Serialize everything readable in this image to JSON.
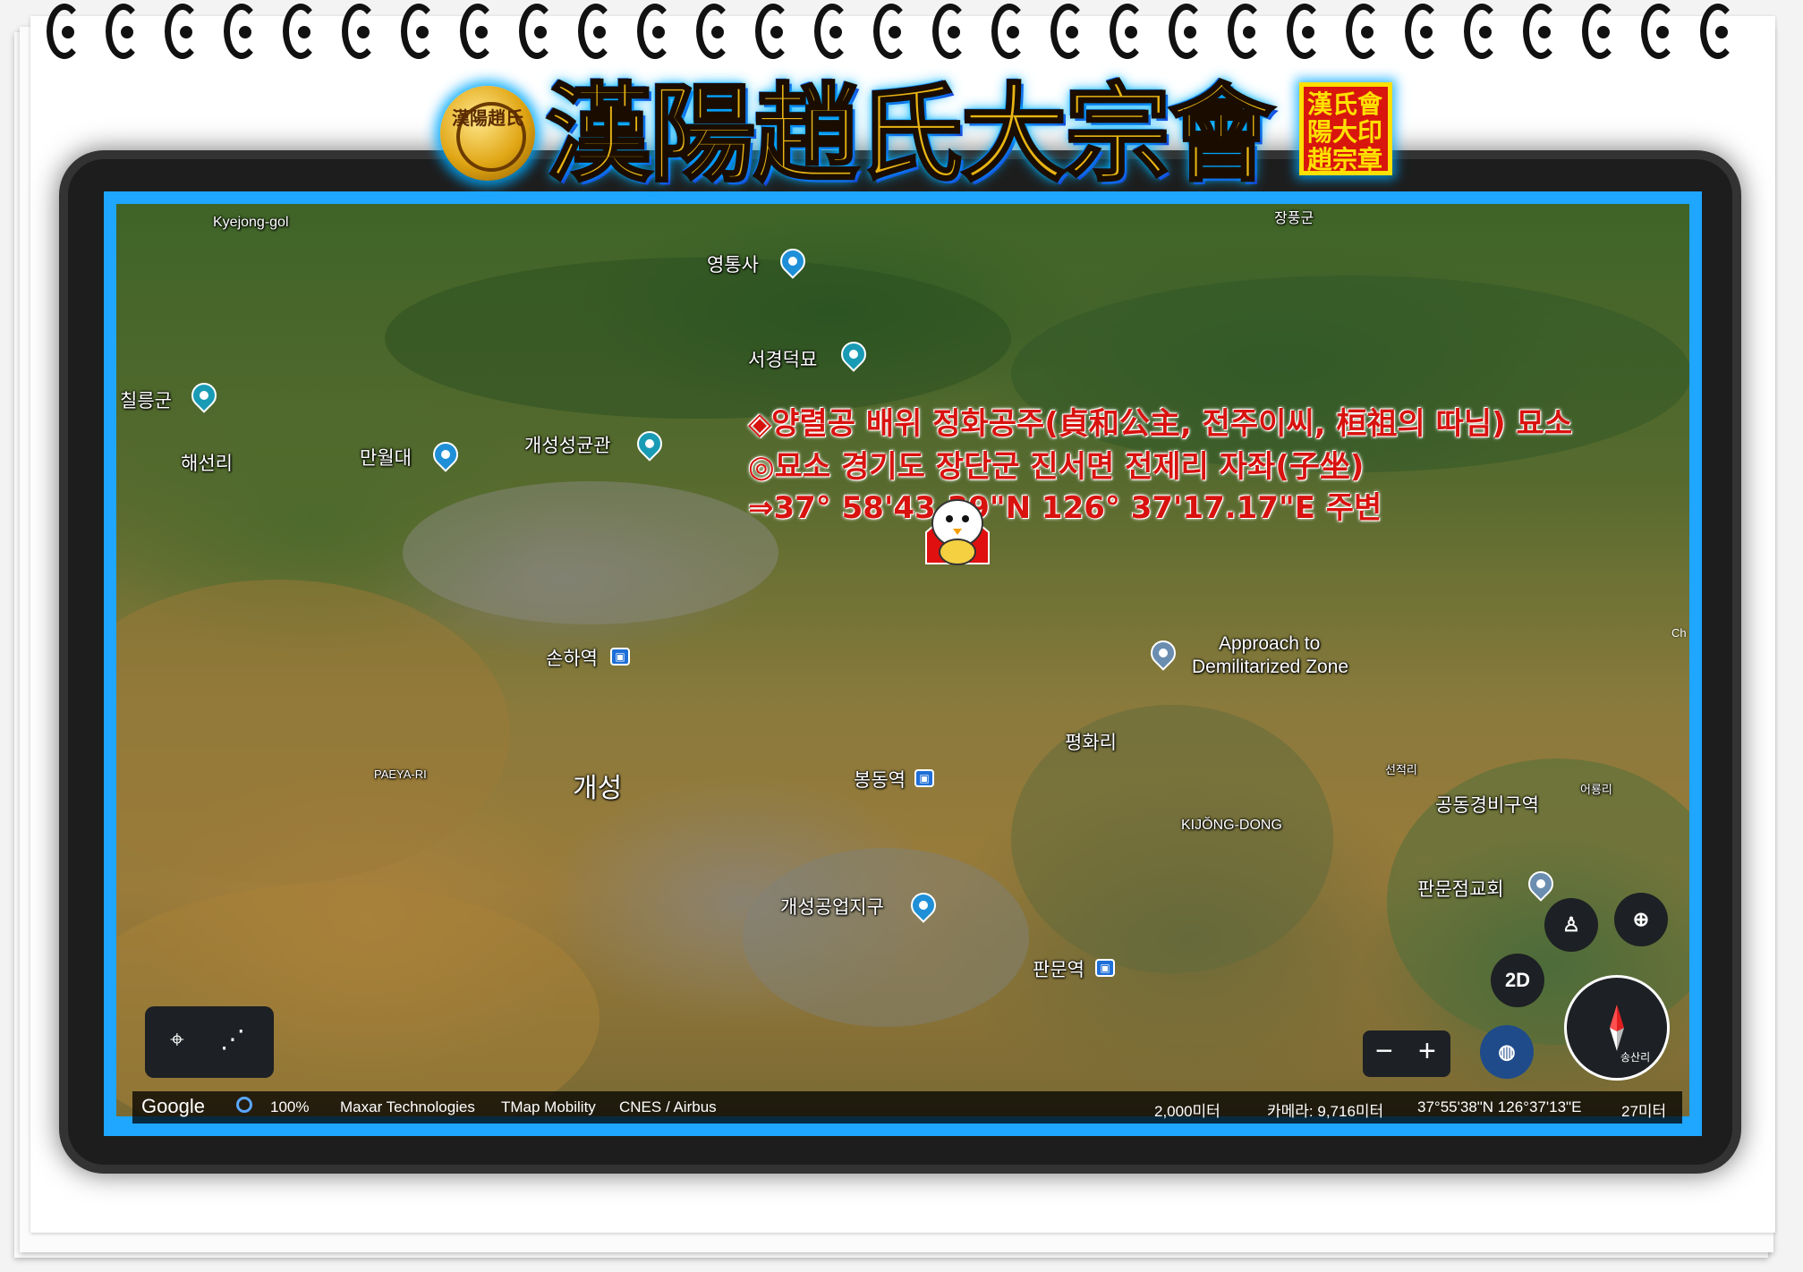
{
  "banner": {
    "seal_text": "漢陽趙氏",
    "title": "漢陽趙氏大宗會",
    "stamp_text": "漢氏會陽大印趙宗章"
  },
  "overlay": {
    "line1": "◈양렬공 배위 정화공주(貞和公主, 전주이씨, 桓祖의 따님) 묘소",
    "line2": "◎묘소 경기도 장단군 진서면 전제리 자좌(子坐)",
    "line3": "⇒37°  58'43.39\"N 126°  37'17.17\"E 주변"
  },
  "places": {
    "kyejong": "Kyejong-gol",
    "jangpung": "장풍군",
    "yeongtongsa": "영통사",
    "seogyeong": "서경덕묘",
    "chilgeun": "칠릉군",
    "haeseonri": "해선리",
    "manwoldae": "만월대",
    "seonggyungwan": "개성성균관",
    "sonhayeok": "손하역",
    "approach_l1": "Approach to",
    "approach_l2": "Demilitarized Zone",
    "pyeonghwari": "평화리",
    "paeya": "PAEYA-RI",
    "gaeseong": "개성",
    "bongdong": "봉동역",
    "seonjeokri": "선적리",
    "gongdong": "공동경비구역",
    "eoryongri": "어룡리",
    "kijong": "KIJŎNG-DONG",
    "panmunjeom_church": "판문점교회",
    "industrial": "개성공업지구",
    "panmunyeok": "판문역",
    "corner": "Ch"
  },
  "controls": {
    "btn_2d": "2D",
    "zoom_minus": "−",
    "zoom_plus": "+",
    "compass_label": "송산리"
  },
  "footer": {
    "google": "Google",
    "zoom": "100%",
    "credit1": "Maxar Technologies",
    "credit2": "TMap Mobility",
    "credit3": "CNES / Airbus",
    "scale": "2,000미터",
    "camera": "카메라: 9,716미터",
    "coords": "37°55'38\"N 126°37'13\"E",
    "elevation": "27미터"
  },
  "colors": {
    "frame_blue": "#1fa6ff",
    "overlay_red": "#d8120e",
    "title_gold": "#e8b414"
  }
}
